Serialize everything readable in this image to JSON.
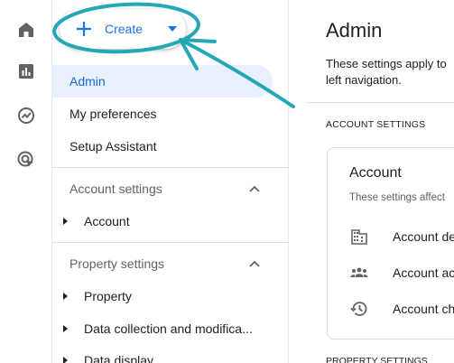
{
  "rail": {
    "items": [
      {
        "icon": "home-icon"
      },
      {
        "icon": "reports-icon"
      },
      {
        "icon": "explore-icon"
      },
      {
        "icon": "advertising-icon"
      }
    ]
  },
  "create": {
    "label": "Create"
  },
  "nav": {
    "items": [
      {
        "label": "Admin",
        "active": true
      },
      {
        "label": "My preferences"
      },
      {
        "label": "Setup Assistant"
      }
    ],
    "account_section": {
      "label": "Account settings",
      "items": [
        {
          "label": "Account"
        }
      ]
    },
    "property_section": {
      "label": "Property settings",
      "items": [
        {
          "label": "Property"
        },
        {
          "label": "Data collection and modifica..."
        },
        {
          "label": "Data display"
        }
      ]
    }
  },
  "main": {
    "title": "Admin",
    "description_line1": "These settings apply to",
    "description_line2": "left navigation.",
    "account_caption": "ACCOUNT SETTINGS",
    "card": {
      "title": "Account",
      "subtitle": "These settings affect",
      "rows": [
        {
          "icon": "building-icon",
          "label": "Account de"
        },
        {
          "icon": "people-icon",
          "label": "Account ac"
        },
        {
          "icon": "history-icon",
          "label": "Account ch"
        }
      ]
    },
    "property_caption": "PROPERTY SETTINGS"
  },
  "colors": {
    "accent": "#1a73e8",
    "active_bg": "#e8f0fe",
    "annotation": "#26a7b8"
  }
}
